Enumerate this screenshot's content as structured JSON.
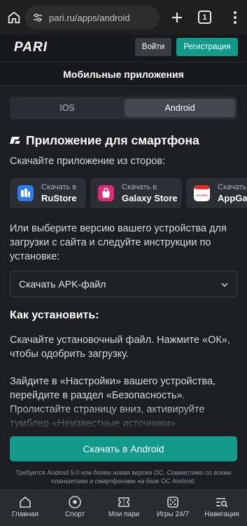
{
  "browser": {
    "url": "pari.ru/apps/android",
    "tab_count": "1",
    "icons": [
      "home-icon",
      "tune-icon",
      "plus-icon",
      "tab-switcher-icon",
      "more-vertical-icon"
    ]
  },
  "header": {
    "logo_text": "PARI",
    "login_label": "Войти",
    "register_label": "Регистрация",
    "accent_color": "#119a8a"
  },
  "page": {
    "title": "Мобильные приложения",
    "os_tabs": [
      {
        "label": "IOS",
        "active": false
      },
      {
        "label": "Android",
        "active": true
      }
    ],
    "section_title": "Приложение для смартфона",
    "stores_text": "Скачайте приложение из сторов:",
    "stores": [
      {
        "top": "Скачать в",
        "name": "RuStore",
        "icon": "rustore-icon"
      },
      {
        "top": "Скачать в",
        "name": "Galaxy Store",
        "icon": "galaxy-store-icon"
      },
      {
        "top": "Скачать в",
        "name": "AppGallery",
        "icon": "huawei-icon"
      }
    ],
    "choose_text": "Или выберите версию вашего устройства для загрузки с сайта и следуйте инструкции по установке:",
    "apk_select_value": "Скачать APK-файл",
    "how_title": "Как установить:",
    "steps": [
      "Скачайте установочный файл. Нажмите «ОК», чтобы одобрить загрузку.",
      "Зайдите в «Настройки» вашего устройства, перейдите в раздел «Безопасность». Пролистайте страницу вниз, активируйте тумблер «Неизвестные источники»."
    ],
    "download_label": "Скачать в Android",
    "requirements": "Требуется Android 5.0 или более новая версия ОС. Совместимо со всеми планшетами и смартфонами на базе ОС Android."
  },
  "bottom_nav": [
    {
      "label": "Главная",
      "icon": "home-icon"
    },
    {
      "label": "Спорт",
      "icon": "ball-icon"
    },
    {
      "label": "Мои пари",
      "icon": "ticket-icon"
    },
    {
      "label": "Игры 24/7",
      "icon": "dice-icon"
    },
    {
      "label": "Навигация",
      "icon": "menu-search-icon"
    }
  ]
}
